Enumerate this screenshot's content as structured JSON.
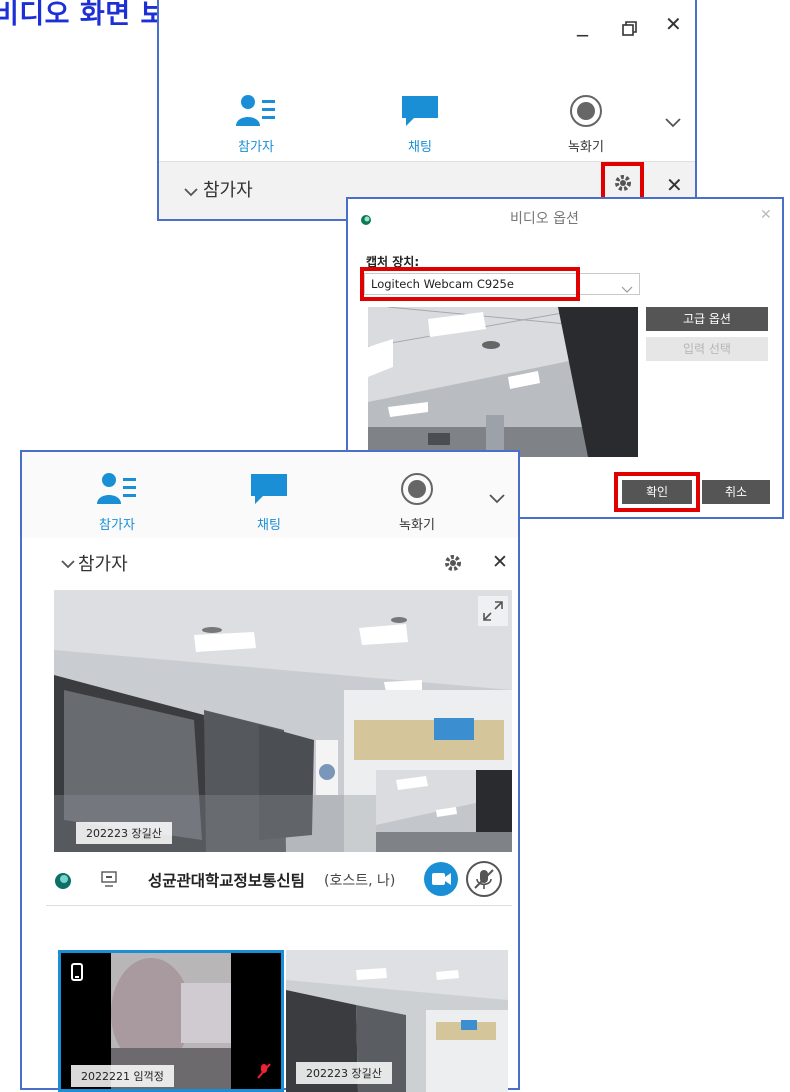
{
  "heading": "비디오 화면 보기",
  "top_window": {
    "tools": [
      {
        "label": "참가자",
        "icon": "participants-icon"
      },
      {
        "label": "채팅",
        "icon": "chat-icon"
      },
      {
        "label": "녹화기",
        "icon": "record-icon"
      }
    ],
    "panel_title": "참가자"
  },
  "video_dialog": {
    "title": "비디오 옵션",
    "capture_label": "캡처 장치:",
    "capture_value": "Logitech Webcam C925e",
    "advanced_label": "고급 옵션",
    "input_select_label": "입력 선택",
    "ok_label": "확인",
    "cancel_label": "취소"
  },
  "bottom_window": {
    "tools": [
      {
        "label": "참가자",
        "icon": "participants-icon"
      },
      {
        "label": "채팅",
        "icon": "chat-icon"
      },
      {
        "label": "녹화기",
        "icon": "record-icon"
      }
    ],
    "panel_title": "참가자",
    "main_video_tag": "202223 장길산",
    "participant_name": "성균관대학교정보통신팀",
    "participant_role": "(호스트, 나)",
    "thumbs": [
      {
        "tag": "2022221 임꺽정"
      },
      {
        "tag": "202223 장길산"
      }
    ]
  },
  "colors": {
    "accent": "#1a8fd6",
    "frame_border": "#4a6fc9",
    "highlight": "#e00000",
    "heading": "#1d2fd6"
  }
}
